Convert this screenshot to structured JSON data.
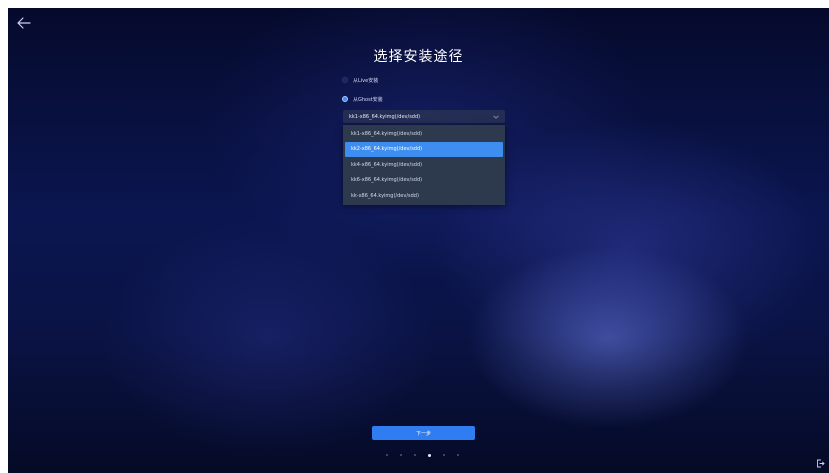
{
  "header": {
    "back_icon": "arrow-left-icon",
    "title": "选择安装途径"
  },
  "install_source": {
    "options": [
      {
        "label": "从Live安装",
        "selected": false
      },
      {
        "label": "从Ghost安装",
        "selected": true
      }
    ]
  },
  "image_select": {
    "value": "kk1-x86_64.kyimg(/dev/sdd)",
    "options": [
      {
        "label": "kk1-x86_64.kyimg(/dev/sdd)",
        "highlighted": false
      },
      {
        "label": "kk2-x86_64.kyimg(/dev/sdd)",
        "highlighted": true
      },
      {
        "label": "kk4-x86_64.kyimg(/dev/sdd)",
        "highlighted": false
      },
      {
        "label": "kk6-x86_64.kyimg(/dev/sdd)",
        "highlighted": false
      },
      {
        "label": "kk-x86_64.kyimg(/dev/sdd)",
        "highlighted": false
      }
    ]
  },
  "footer": {
    "next_label": "下一步",
    "pager": {
      "total": 6,
      "active": 3
    },
    "power_icon": "power-exit-icon"
  },
  "colors": {
    "accent": "#3d8ef0",
    "button": "#2f7df0",
    "dropdown_bg": "#2d3a4e",
    "background_top": "#050a2c"
  }
}
